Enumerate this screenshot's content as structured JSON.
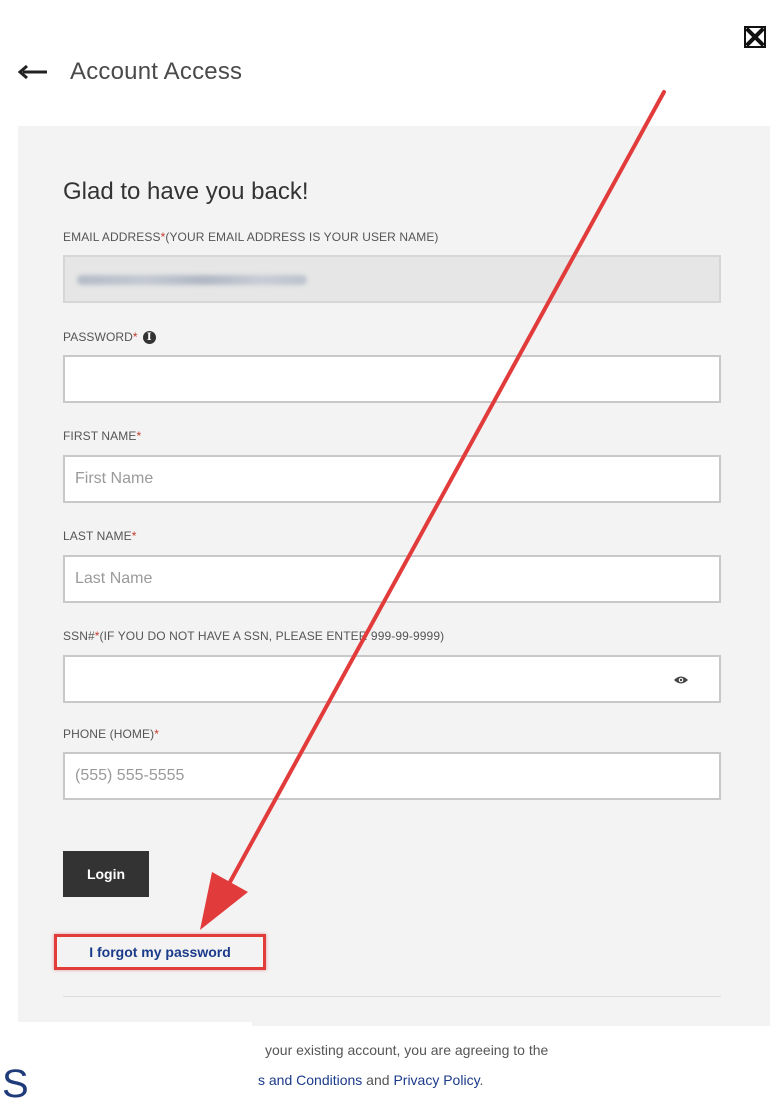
{
  "header": {
    "title": "Account Access",
    "back_icon": "arrow-left-icon",
    "close_icon": "close-icon"
  },
  "form": {
    "greeting": "Glad to have you back!",
    "email": {
      "label": "EMAIL ADDRESS",
      "required_mark": "*",
      "note": " (YOUR EMAIL ADDRESS IS YOUR USER NAME)"
    },
    "password": {
      "label": "PASSWORD",
      "required_mark": "*",
      "info_icon": "i"
    },
    "first_name": {
      "label": "FIRST NAME",
      "required_mark": "*",
      "placeholder": "First Name"
    },
    "last_name": {
      "label": "LAST NAME",
      "required_mark": "*",
      "placeholder": "Last Name"
    },
    "ssn": {
      "label": "SSN#",
      "required_mark": "*",
      "note": " (IF YOU DO NOT HAVE A SSN, PLEASE ENTER 999-99-9999)"
    },
    "phone": {
      "label": "PHONE (HOME)",
      "required_mark": "*",
      "placeholder": "(555) 555-5555"
    },
    "login_label": "Login",
    "forgot_label": "I forgot my password"
  },
  "footer": {
    "terms_line1": "your existing account, you are agreeing to the",
    "terms_prefix": "s",
    "terms_link1": "and Conditions",
    "terms_and": " and ",
    "terms_link2": "Privacy Policy",
    "terms_period": ".",
    "big_letter": "S"
  },
  "colors": {
    "panel_bg": "#f3f3f3",
    "button_bg": "#333333",
    "link": "#1a3a8a",
    "required": "#c0392b",
    "annotation": "#e23b3b"
  }
}
